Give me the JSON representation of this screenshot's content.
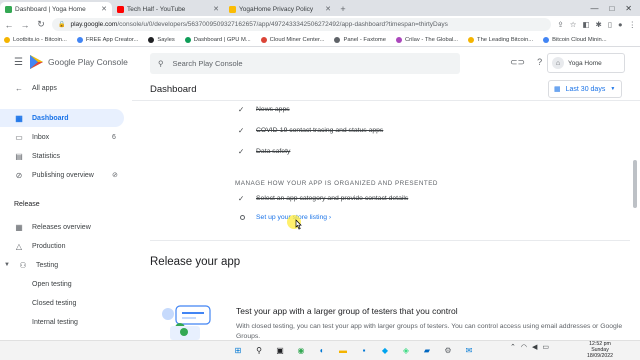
{
  "browser": {
    "tabs": [
      {
        "title": "Dashboard | Yoga Home",
        "color": "#34a853",
        "active": true
      },
      {
        "title": "Tech Half - YouTube",
        "color": "#ff0000",
        "active": false
      },
      {
        "title": "YogaHome Privacy Policy",
        "color": "#fbbc04",
        "active": false
      }
    ],
    "new_tab": "+",
    "window_controls": [
      "—",
      "□",
      "✕"
    ],
    "url_host": "play.google.com",
    "url_path": "/console/u/0/developers/5637009509327162657/app/4972433342506272492/app-dashboard?timespan=thirtyDays",
    "bookmarks": [
      {
        "label": "Lootbits.io - Bitcoin...",
        "color": "#f4b400"
      },
      {
        "label": "FREE App Creator...",
        "color": "#4285f4"
      },
      {
        "label": "Sayles",
        "color": "#202124"
      },
      {
        "label": "Dashboard | GPU M...",
        "color": "#0f9d58"
      },
      {
        "label": "Cloud Miner Center...",
        "color": "#db4437"
      },
      {
        "label": "Panel - Faxtome",
        "color": "#5f6368"
      },
      {
        "label": "Crilav - The Global...",
        "color": "#ab47bc"
      },
      {
        "label": "The Leading Bitcoin...",
        "color": "#f4b400"
      },
      {
        "label": "Bitcoin Cloud Minin...",
        "color": "#4285f4"
      }
    ]
  },
  "console": {
    "product_name": "Google Play Console",
    "search_placeholder": "Search Play Console",
    "account_name": "Yoga Home",
    "page_title": "Dashboard",
    "date_range": "Last 30 days"
  },
  "sidebar": {
    "all_apps": "All apps",
    "items": [
      {
        "label": "Dashboard",
        "icon": "dashboard-icon",
        "glyph": "▦"
      },
      {
        "label": "Inbox",
        "icon": "inbox-icon",
        "glyph": "▭",
        "count": "6"
      },
      {
        "label": "Statistics",
        "icon": "statistics-icon",
        "glyph": "▤"
      },
      {
        "label": "Publishing overview",
        "icon": "publishing-icon",
        "glyph": "⊘"
      }
    ],
    "release_section": "Release",
    "release_items": [
      {
        "label": "Releases overview",
        "icon": "releases-icon",
        "glyph": "▦"
      },
      {
        "label": "Production",
        "icon": "production-icon",
        "glyph": "△"
      },
      {
        "label": "Testing",
        "icon": "testing-icon",
        "glyph": "⚇"
      }
    ],
    "testing_sub": [
      "Open testing",
      "Closed testing",
      "Internal testing"
    ]
  },
  "tasks": {
    "completed": [
      "News apps",
      "COVID-19 contact tracing and status apps",
      "Data safety"
    ],
    "section_header": "MANAGE HOW YOUR APP IS ORGANIZED AND PRESENTED",
    "completed_2": "Select an app category and provide contact details",
    "pending_link": "Set up your store listing",
    "pending_arrow": "›"
  },
  "release": {
    "heading": "Release your app",
    "test_title": "Test your app with a larger group of testers that you control",
    "test_desc": "With closed testing, you can test your app with larger groups of testers. You can control access using email addresses or Google Groups."
  },
  "taskbar": {
    "time": "12:52 pm",
    "day": "Sunday",
    "date": "18/09/2022",
    "apps": [
      {
        "icon": "start-icon",
        "glyph": "⊞",
        "color": "#0078d4"
      },
      {
        "icon": "search-icon",
        "glyph": "⚲",
        "color": "#202124"
      },
      {
        "icon": "taskview-icon",
        "glyph": "▣",
        "color": "#202124"
      },
      {
        "icon": "chrome-icon",
        "glyph": "◉",
        "color": "#34a853"
      },
      {
        "icon": "edge-icon",
        "glyph": "◐",
        "color": "#0078d4"
      },
      {
        "icon": "files-icon",
        "glyph": "▬",
        "color": "#f4b400"
      },
      {
        "icon": "store-icon",
        "glyph": "▪",
        "color": "#0078d4"
      },
      {
        "icon": "app-icon",
        "glyph": "◆",
        "color": "#00a4ef"
      },
      {
        "icon": "studio-icon",
        "glyph": "◈",
        "color": "#3ddc84"
      },
      {
        "icon": "photos-icon",
        "glyph": "▰",
        "color": "#0067c0"
      },
      {
        "icon": "settings-icon",
        "glyph": "⚙",
        "color": "#5f6368"
      },
      {
        "icon": "mail-icon",
        "glyph": "✉",
        "color": "#0078d4"
      }
    ]
  }
}
